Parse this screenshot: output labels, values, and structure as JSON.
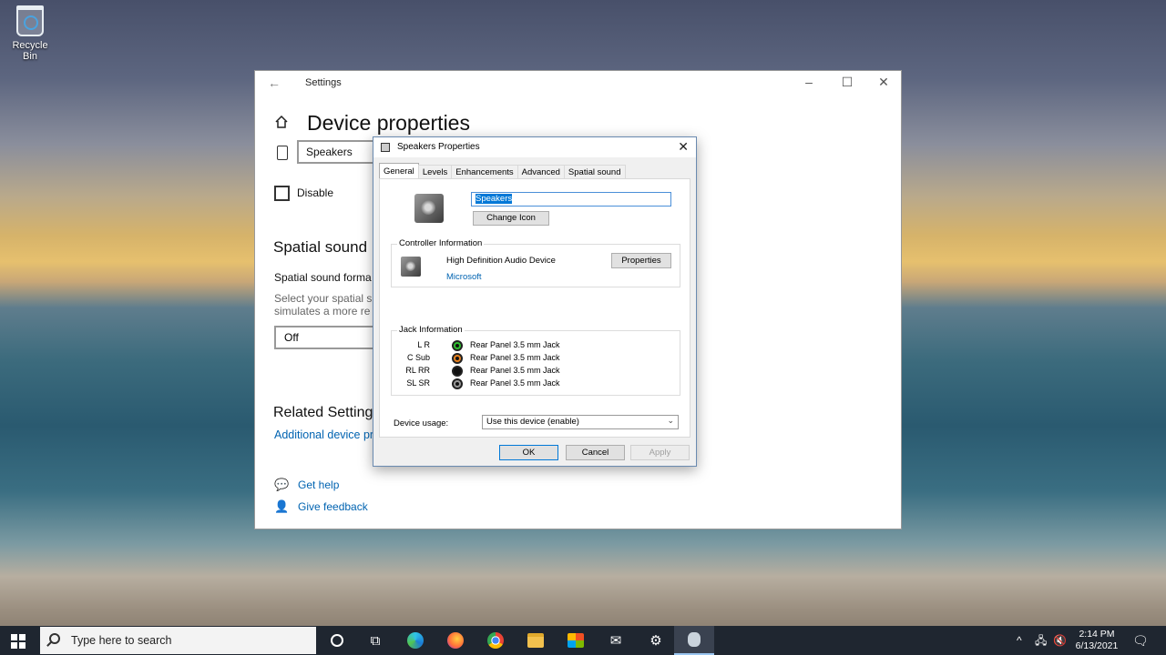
{
  "desktop": {
    "recycle_bin_label": "Recycle Bin"
  },
  "settings": {
    "window_title": "Settings",
    "page_title": "Device properties",
    "device_name": "Speakers",
    "disable_label": "Disable",
    "spatial_heading": "Spatial sound",
    "spatial_format_label": "Spatial sound forma",
    "spatial_desc_line1": "Select your spatial s",
    "spatial_desc_line2": "simulates a more re",
    "spatial_value": "Off",
    "related_heading": "Related Setting",
    "related_link": "Additional device pr",
    "get_help": "Get help",
    "give_feedback": "Give feedback"
  },
  "dialog": {
    "title": "Speakers Properties",
    "tabs": [
      "General",
      "Levels",
      "Enhancements",
      "Advanced",
      "Spatial sound"
    ],
    "name_value": "Speakers",
    "change_icon": "Change Icon",
    "controller_group": "Controller Information",
    "controller_name": "High Definition Audio Device",
    "controller_vendor": "Microsoft",
    "properties_button": "Properties",
    "jack_group": "Jack Information",
    "jacks": [
      {
        "label": "L R",
        "text": "Rear Panel 3.5 mm Jack",
        "color": "#2fbf2f"
      },
      {
        "label": "C Sub",
        "text": "Rear Panel 3.5 mm Jack",
        "color": "#e8811e"
      },
      {
        "label": "RL RR",
        "text": "Rear Panel 3.5 mm Jack",
        "color": "#111111"
      },
      {
        "label": "SL SR",
        "text": "Rear Panel 3.5 mm Jack",
        "color": "#9a9a9a"
      }
    ],
    "device_usage_label": "Device usage:",
    "device_usage_value": "Use this device (enable)",
    "ok": "OK",
    "cancel": "Cancel",
    "apply": "Apply"
  },
  "taskbar": {
    "search_placeholder": "Type here to search",
    "time": "2:14 PM",
    "date": "6/13/2021"
  }
}
